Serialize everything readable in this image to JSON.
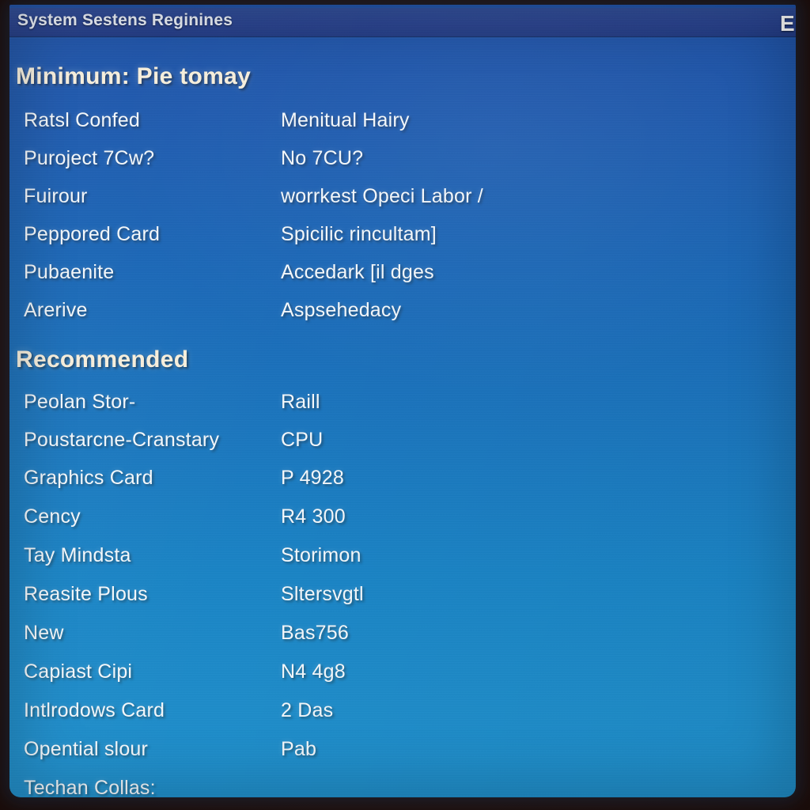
{
  "window": {
    "title": "System Sestens Reginines",
    "corner_glyph": "E",
    "accent_title_bar": "#26408d",
    "background_top": "#1d4fa4",
    "background_bottom": "#1f8fcb",
    "heading_color": "#f7efdc",
    "text_color": "#f4f8fb"
  },
  "sections": [
    {
      "heading": "Minimum: Pie tomay",
      "rows": [
        {
          "label": "Ratsl Confed",
          "value": "Menitual Hairy"
        },
        {
          "label": "Puroject 7Cw?",
          "value": "No 7CU?"
        },
        {
          "label": "Fuirour",
          "value": "worrkest Opeci Labor /"
        },
        {
          "label": "Peppored Card",
          "value": "Spicilic rincultam]"
        },
        {
          "label": "Pubaenite",
          "value": "Accedark [il dges"
        },
        {
          "label": "Arerive",
          "value": "Aspsehedacy"
        }
      ]
    },
    {
      "heading": "Recommended",
      "rows": [
        {
          "label": "Peolan Stor-",
          "value": "Raill"
        },
        {
          "label": "Poustarcne-Cranstary",
          "value": "CPU"
        },
        {
          "label": "Graphics Card",
          "value": "P 4928"
        },
        {
          "label": "Cency",
          "value": "R4 300"
        },
        {
          "label": "Tay Mindsta",
          "value": "Storimon"
        },
        {
          "label": "Reasite Plous",
          "value": "Sltersvgtl"
        },
        {
          "label": "New",
          "value": "Bas756"
        },
        {
          "label": "Capiast Cipi",
          "value": "N4 4g8"
        },
        {
          "label": "Intlrodows Card",
          "value": "2 Das"
        },
        {
          "label": "Opential slour",
          "value": "Pab"
        }
      ]
    }
  ],
  "footer": {
    "label": "Techan Collas:"
  }
}
